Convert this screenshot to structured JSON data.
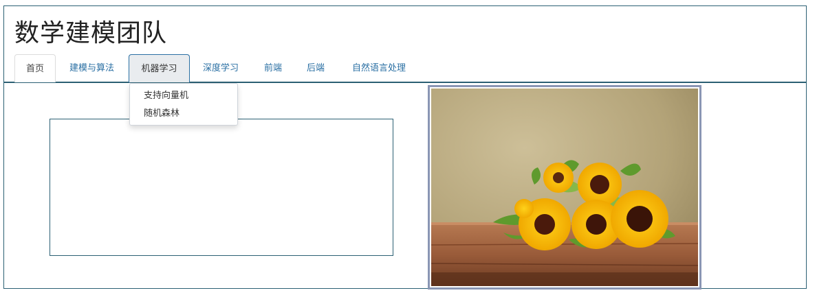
{
  "site": {
    "title": "数学建模团队"
  },
  "nav": {
    "tabs": [
      {
        "label": "首页",
        "state": "active"
      },
      {
        "label": "建模与算法",
        "state": "normal"
      },
      {
        "label": "机器学习",
        "state": "open"
      },
      {
        "label": "深度学习",
        "state": "normal"
      },
      {
        "label": "前端",
        "state": "normal"
      },
      {
        "label": "后端",
        "state": "normal"
      },
      {
        "label": "自然语言处理",
        "state": "normal"
      }
    ],
    "dropdown": {
      "items": [
        {
          "label": "支持向量机"
        },
        {
          "label": "随机森林"
        }
      ]
    }
  },
  "colors": {
    "border": "#2a5f73",
    "link": "#2a6fa3",
    "photo_border": "#8a96b4"
  },
  "image": {
    "subject": "sunflowers-on-wooden-table"
  }
}
